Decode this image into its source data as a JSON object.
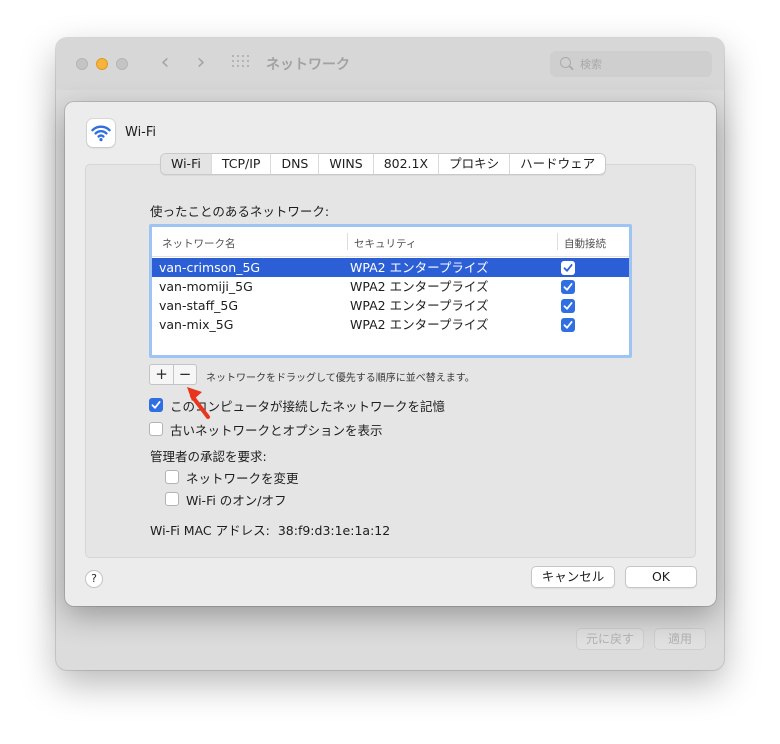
{
  "background_window": {
    "title": "ネットワーク",
    "search_placeholder": "検索",
    "revert_label": "元に戻す",
    "apply_label": "適用"
  },
  "sheet": {
    "title": "Wi-Fi",
    "tabs": [
      "Wi-Fi",
      "TCP/IP",
      "DNS",
      "WINS",
      "802.1X",
      "プロキシ",
      "ハードウェア"
    ],
    "selected_tab": "Wi-Fi",
    "preferred_networks_label": "使ったことのあるネットワーク:",
    "table": {
      "columns": [
        "ネットワーク名",
        "セキュリティ",
        "自動接続"
      ],
      "rows": [
        {
          "name": "van-crimson_5G",
          "security": "WPA2 エンタープライズ",
          "auto_join": true,
          "selected": true
        },
        {
          "name": "van-momiji_5G",
          "security": "WPA2 エンタープライズ",
          "auto_join": true,
          "selected": false
        },
        {
          "name": "van-staff_5G",
          "security": "WPA2 エンタープライズ",
          "auto_join": true,
          "selected": false
        },
        {
          "name": "van-mix_5G",
          "security": "WPA2 エンタープライズ",
          "auto_join": true,
          "selected": false
        }
      ]
    },
    "add_label": "+",
    "remove_label": "−",
    "drag_hint": "ネットワークをドラッグして優先する順序に並べ替えます。",
    "remember_networks": {
      "label": "このコンピュータが接続したネットワークを記憶",
      "checked": true
    },
    "show_legacy": {
      "label": "古いネットワークとオプションを表示",
      "checked": false
    },
    "admin_label": "管理者の承認を要求:",
    "change_networks": {
      "label": "ネットワークを変更",
      "checked": false
    },
    "toggle_wifi": {
      "label": "Wi-Fi のオン/オフ",
      "checked": false
    },
    "mac_label": "Wi-Fi MAC アドレス:",
    "mac_value": "38:f9:d3:1e:1a:12",
    "help_label": "?",
    "cancel_label": "キャンセル",
    "ok_label": "OK"
  },
  "colors": {
    "selection": "#2c5fd5",
    "checkbox": "#2f6fe2",
    "annotation_arrow": "#e8351e"
  }
}
